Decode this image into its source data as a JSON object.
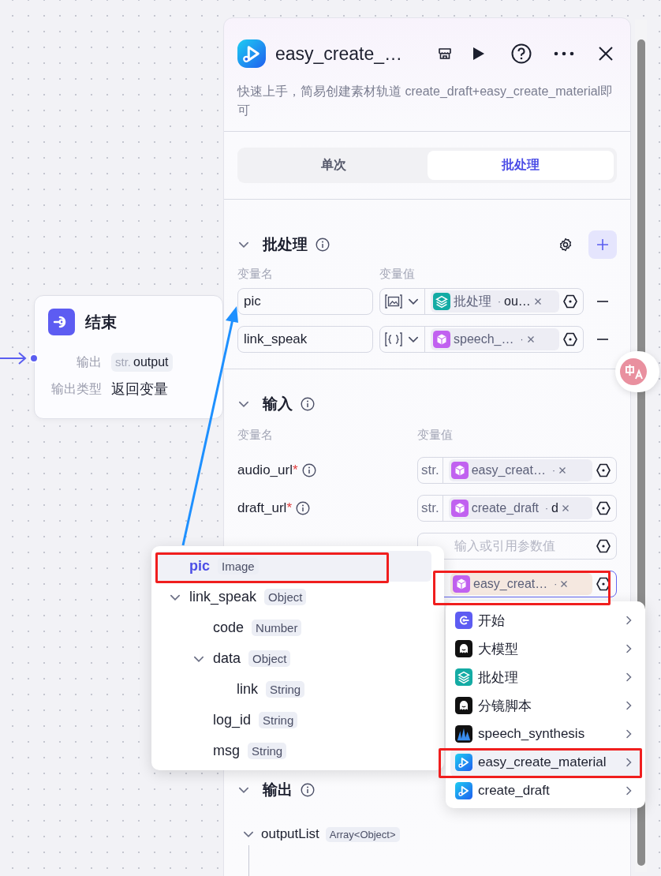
{
  "canvas": {
    "node": {
      "title": "结束",
      "fields": [
        {
          "kind": "tag",
          "label": "输出",
          "type": "str.",
          "value": "output"
        },
        {
          "kind": "text",
          "label": "输出类型",
          "value": "返回变量"
        }
      ]
    }
  },
  "panel": {
    "title": "easy_create_…",
    "description": "快速上手，简易创建素材轨道 create_draft+easy_create_material即可",
    "tabs": [
      {
        "label": "单次",
        "selected": false
      },
      {
        "label": "批处理",
        "selected": true
      }
    ],
    "batch": {
      "title": "批处理",
      "expanded": true,
      "name_header": "变量名",
      "value_header": "变量值",
      "rows": [
        {
          "name": "pic",
          "kind": "image",
          "ref": {
            "kind": "batch",
            "node": "批处理",
            "sep": "·",
            "field": "ou…"
          }
        },
        {
          "name": "link_speak",
          "kind": "object",
          "ref": {
            "kind": "plugin",
            "node": "speech_…",
            "sep": "·"
          }
        }
      ]
    },
    "input": {
      "title": "输入",
      "expanded": true,
      "name_header": "变量名",
      "value_header": "变量值",
      "rows": [
        {
          "name": "audio_url",
          "mark": "*",
          "type": "str.",
          "ref": {
            "kind": "plugin",
            "node": "easy_creat…",
            "sep": "·"
          },
          "focused": false
        },
        {
          "name": "draft_url",
          "mark": "*",
          "type": "str.",
          "ref": {
            "kind": "plugin",
            "node": "create_draft",
            "sep": "·",
            "field": "d"
          },
          "focused": false
        },
        {
          "placeholder": "输入或引用参数值",
          "focused": false
        },
        {
          "ref": {
            "kind": "plugin",
            "node": "easy_creat…",
            "sep": "·"
          },
          "focused": true
        }
      ]
    },
    "output": {
      "title": "输出",
      "expanded": true,
      "items": [
        {
          "name": "outputList",
          "type": "Array<Object>",
          "expanded": true
        }
      ]
    }
  },
  "variable_picker": {
    "items": [
      {
        "name": "pic",
        "type": "Image",
        "selected": true
      },
      {
        "name": "link_speak",
        "type": "Object",
        "selected": false,
        "expanded": true,
        "children": [
          {
            "name": "code",
            "type": "Number",
            "selected": false
          },
          {
            "name": "data",
            "type": "Object",
            "selected": false,
            "expanded": true,
            "children": [
              {
                "name": "link",
                "type": "String",
                "selected": false
              }
            ]
          },
          {
            "name": "log_id",
            "type": "String",
            "selected": false
          },
          {
            "name": "msg",
            "type": "String",
            "selected": false
          }
        ]
      }
    ]
  },
  "node_menu": {
    "items": [
      {
        "kind": "start",
        "label": "开始",
        "selected": false
      },
      {
        "kind": "llm",
        "label": "大模型",
        "selected": false
      },
      {
        "kind": "batch",
        "label": "批处理",
        "selected": false
      },
      {
        "kind": "llm",
        "label": "分镜脚本",
        "selected": false
      },
      {
        "kind": "speech",
        "label": "speech_synthesis",
        "selected": false
      },
      {
        "kind": "video",
        "label": "easy_create_material",
        "selected": true
      },
      {
        "kind": "video",
        "label": "create_draft",
        "selected": false
      }
    ]
  },
  "annotations": [
    {
      "kind": "box"
    },
    {
      "kind": "box"
    },
    {
      "kind": "box"
    },
    {
      "kind": "arrow"
    }
  ]
}
